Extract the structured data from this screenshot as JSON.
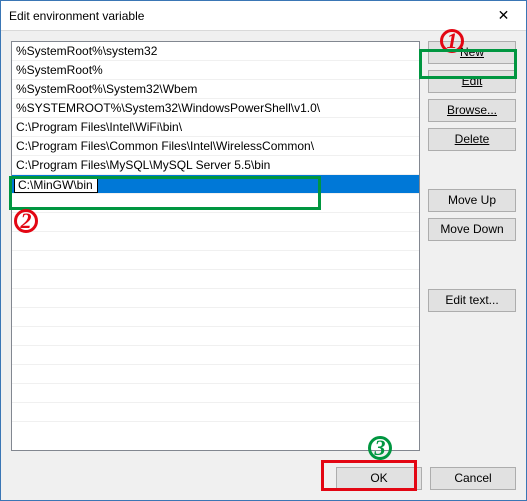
{
  "window": {
    "title": "Edit environment variable",
    "close_glyph": "✕"
  },
  "list": {
    "items": [
      "%SystemRoot%\\system32",
      "%SystemRoot%",
      "%SystemRoot%\\System32\\Wbem",
      "%SYSTEMROOT%\\System32\\WindowsPowerShell\\v1.0\\",
      "C:\\Program Files\\Intel\\WiFi\\bin\\",
      "C:\\Program Files\\Common Files\\Intel\\WirelessCommon\\",
      "C:\\Program Files\\MySQL\\MySQL Server 5.5\\bin"
    ],
    "editing_value": "C:\\MinGW\\bin",
    "blank_rows": 12
  },
  "buttons": {
    "new": "New",
    "edit": "Edit",
    "browse": "Browse...",
    "delete": "Delete",
    "move_up": "Move Up",
    "move_down": "Move Down",
    "edit_text": "Edit text...",
    "ok": "OK",
    "cancel": "Cancel"
  },
  "annotations": {
    "num1": "1",
    "num2": "2",
    "num3": "3",
    "color_red": "#e30613",
    "color_green": "#009640"
  }
}
